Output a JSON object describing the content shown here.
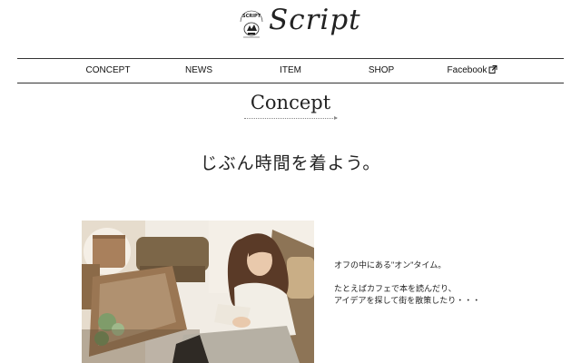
{
  "brand": {
    "name": "Script",
    "badge_text": "SCRIPT"
  },
  "nav": {
    "items": [
      {
        "label": "CONCEPT"
      },
      {
        "label": "NEWS"
      },
      {
        "label": "ITEM"
      },
      {
        "label": "SHOP"
      },
      {
        "label": "Facebook",
        "icon": "external-link-icon"
      }
    ]
  },
  "concept": {
    "title": "Concept",
    "tagline": "じぶん時間を着よう。",
    "paragraphs": [
      "オフの中にある\"オン\"タイム。",
      "たとえばカフェで本を読んだり、",
      "アイデアを探して街を散策したり・・・"
    ]
  },
  "colors": {
    "text": "#222222",
    "rule": "#333333",
    "background": "#ffffff"
  }
}
